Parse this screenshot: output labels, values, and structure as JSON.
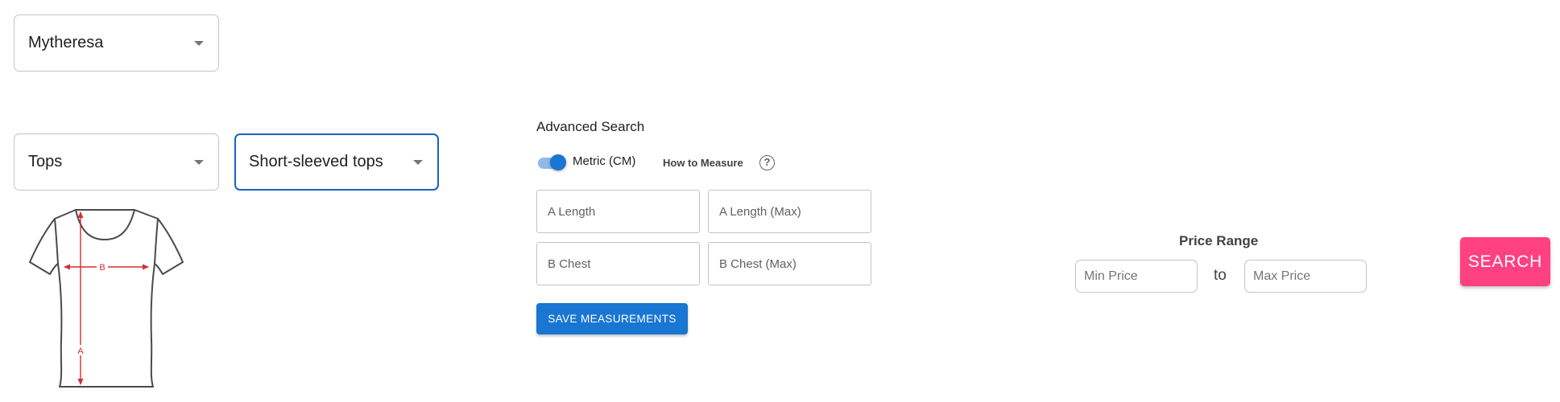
{
  "filters": {
    "brand": "Mytheresa",
    "category": "Tops",
    "subcategory": "Short-sleeved tops"
  },
  "diagram": {
    "label_a": "A",
    "label_b": "B",
    "line_color": "#d32f2f",
    "icon": "tshirt-measurement-diagram"
  },
  "advanced": {
    "title": "Advanced Search",
    "toggle_label": "Metric (CM)",
    "toggle_on": true,
    "how_to": "How to Measure",
    "help_glyph": "?",
    "fields": {
      "a_length": "A Length",
      "a_length_max": "A Length (Max)",
      "b_chest": "B Chest",
      "b_chest_max": "B Chest (Max)"
    },
    "save_label": "SAVE MEASUREMENTS",
    "accent": "#1976d2"
  },
  "price": {
    "title": "Price Range",
    "min_placeholder": "Min Price",
    "max_placeholder": "Max Price",
    "to_label": "to"
  },
  "search": {
    "label": "SEARCH",
    "color": "#ff4081"
  }
}
